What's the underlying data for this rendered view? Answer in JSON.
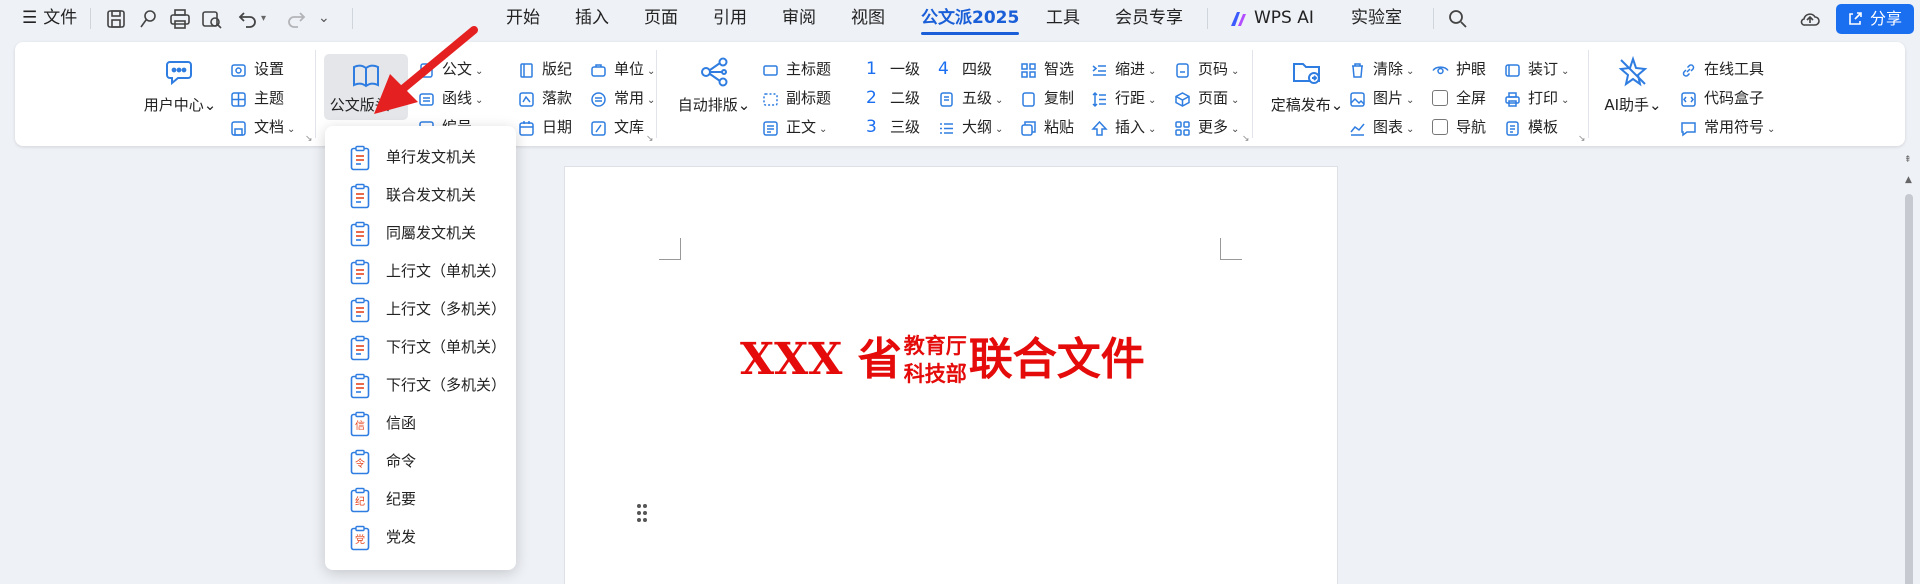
{
  "menubar": {
    "file_label": "文件",
    "tabs": [
      "开始",
      "插入",
      "页面",
      "引用",
      "审阅",
      "视图",
      "公文派2025",
      "工具",
      "会员专享",
      "WPS AI",
      "实验室"
    ],
    "active_tab": "公文派2025",
    "share_label": "分享"
  },
  "ribbon": {
    "user_center": "用户中心",
    "settings": "设置",
    "theme": "主题",
    "document": "文档",
    "header_layout": "公文版头",
    "official_doc": "公文",
    "letter_line": "函线",
    "doc_number": "编号",
    "layout_note": "版纪",
    "signature": "落款",
    "date": "日期",
    "unit": "单位",
    "common": "常用",
    "library": "文库",
    "auto_layout": "自动排版",
    "main_title": "主标题",
    "subtitle": "副标题",
    "body_text": "正文",
    "level1_num": "1",
    "level1": "一级",
    "level2_num": "2",
    "level2": "二级",
    "level3_num": "3",
    "level3": "三级",
    "level4_num": "4",
    "level4": "四级",
    "level5": "五级",
    "outline": "大纲",
    "smart_select": "智选",
    "copy": "复制",
    "paste": "粘贴",
    "indent": "缩进",
    "line_spacing": "行距",
    "insert": "插入",
    "page_number": "页码",
    "page": "页面",
    "more": "更多",
    "finalize_publish": "定稿发布",
    "clear": "清除",
    "image": "图片",
    "chart": "图表",
    "eye_care": "护眼",
    "fullscreen": "全屏",
    "navigation": "导航",
    "binding": "装订",
    "print": "打印",
    "template": "模板",
    "ai_assistant": "AI助手",
    "online_tools": "在线工具",
    "code_box": "代码盒子",
    "common_symbols": "常用符号"
  },
  "dropdown": {
    "items": [
      {
        "label": "单行发文机关",
        "badge": ""
      },
      {
        "label": "联合发文机关",
        "badge": ""
      },
      {
        "label": "同屬发文机关",
        "badge": ""
      },
      {
        "label": "上行文（单机关）",
        "badge": ""
      },
      {
        "label": "上行文（多机关）",
        "badge": ""
      },
      {
        "label": "下行文（单机关）",
        "badge": ""
      },
      {
        "label": "下行文（多机关）",
        "badge": ""
      },
      {
        "label": "信函",
        "badge": "信"
      },
      {
        "label": "命令",
        "badge": "令"
      },
      {
        "label": "纪要",
        "badge": "纪"
      },
      {
        "label": "党发",
        "badge": "党"
      }
    ]
  },
  "document": {
    "title_prefix": "XXX 省",
    "title_org1": "教育厅",
    "title_org2": "科技部",
    "title_suffix": "联合文件"
  },
  "colors": {
    "accent": "#1a5fd8",
    "share_button": "#1a6ef0",
    "doc_title_red": "#e50b0b",
    "icon_blue": "#2f7de1",
    "arrow_red": "#e52020"
  }
}
